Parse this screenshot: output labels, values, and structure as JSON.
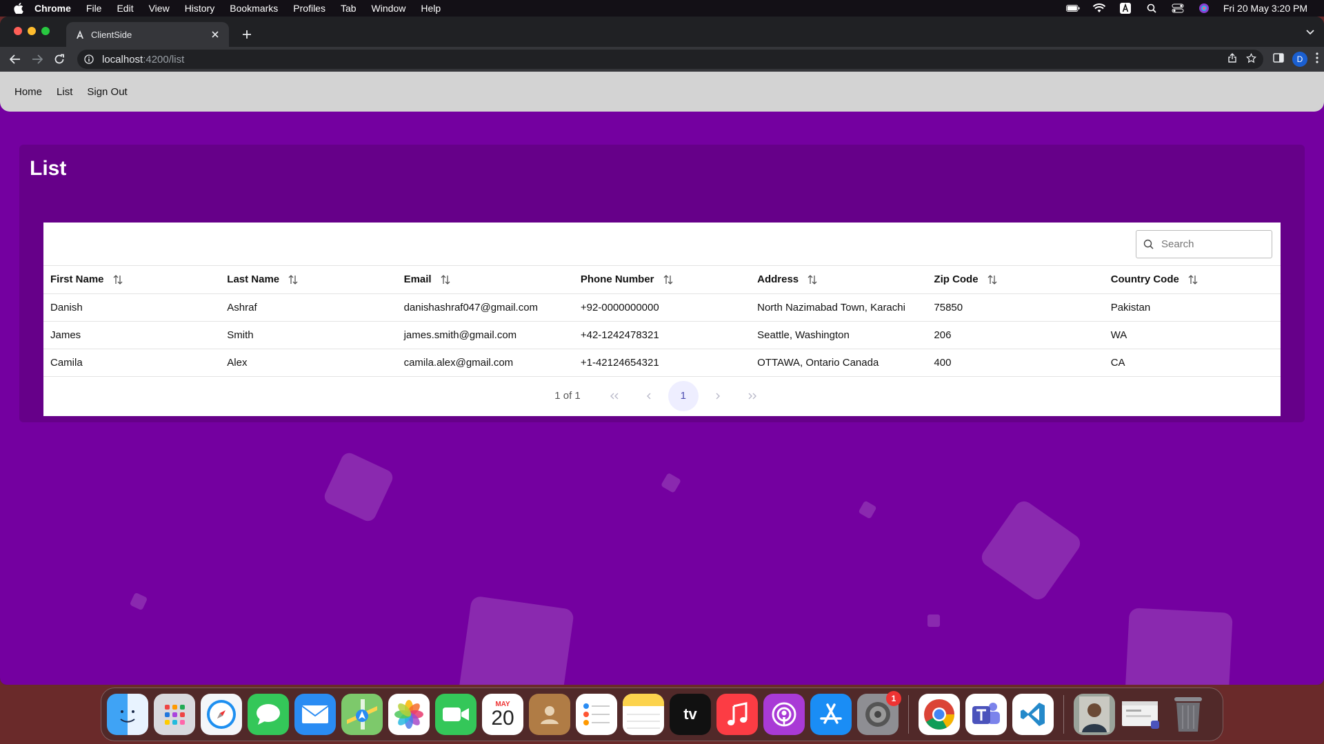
{
  "menubar": {
    "app_name": "Chrome",
    "items": [
      "File",
      "Edit",
      "View",
      "History",
      "Bookmarks",
      "Profiles",
      "Tab",
      "Window",
      "Help"
    ],
    "clock": "Fri 20 May  3:20 PM"
  },
  "browser": {
    "tab_title": "ClientSide",
    "url_host": "localhost",
    "url_path": ":4200/list",
    "profile_initial": "D"
  },
  "nav": {
    "links": [
      "Home",
      "List",
      "Sign Out"
    ]
  },
  "page": {
    "title": "List",
    "search_placeholder": "Search"
  },
  "table": {
    "columns": [
      "First Name",
      "Last Name",
      "Email",
      "Phone Number",
      "Address",
      "Zip Code",
      "Country Code"
    ],
    "rows": [
      [
        "Danish",
        "Ashraf",
        "danishashraf047@gmail.com",
        "+92-0000000000",
        "North Nazimabad Town, Karachi",
        "75850",
        "Pakistan"
      ],
      [
        "James",
        "Smith",
        "james.smith@gmail.com",
        "+42-1242478321",
        "Seattle, Washington",
        "206",
        "WA"
      ],
      [
        "Camila",
        "Alex",
        "camila.alex@gmail.com",
        "+1-42124654321",
        "OTTAWA, Ontario Canada",
        "400",
        "CA"
      ]
    ]
  },
  "pagination": {
    "info": "1 of 1",
    "current_page": "1"
  },
  "dock": {
    "calendar_month": "MAY",
    "calendar_day": "20",
    "settings_badge": "1"
  },
  "colors": {
    "page_bg": "#7400a0",
    "card_bg": "#660089",
    "nav_bg": "#d3d3d3"
  }
}
